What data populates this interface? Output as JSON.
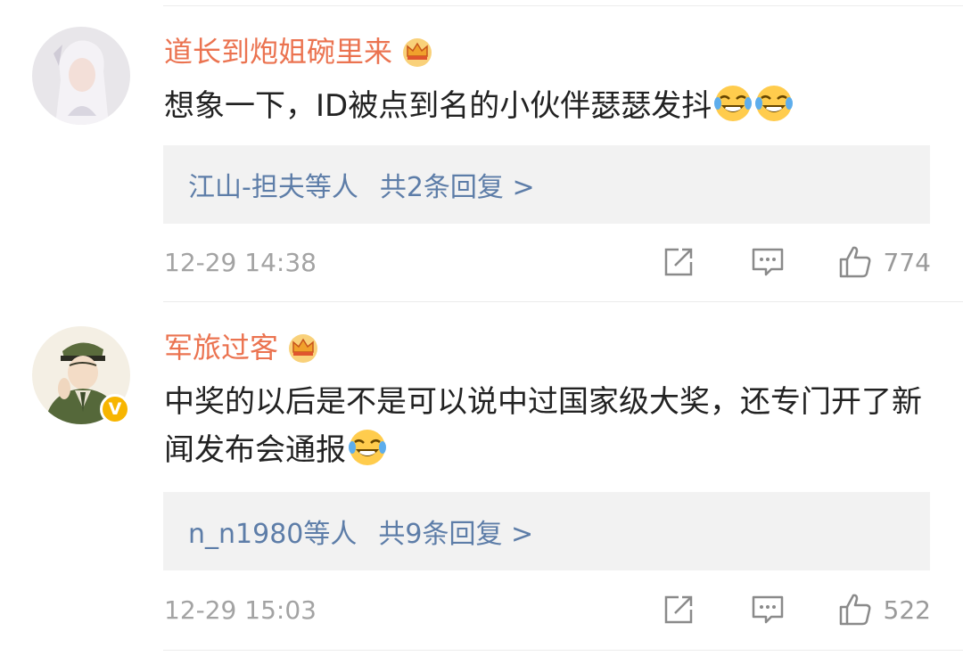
{
  "comments": [
    {
      "username": "道长到炮姐碗里来",
      "has_crown": true,
      "verified": false,
      "text": "想象一下，ID被点到名的小伙伴瑟瑟发抖",
      "emojis": [
        "laugh-cry-emoji",
        "laugh-cry-emoji"
      ],
      "reply_names": "江山-担夫等人",
      "reply_count_label": "共2条回复 >",
      "time": "12-29 14:38",
      "likes": "774"
    },
    {
      "username": "军旅过客",
      "has_crown": true,
      "verified": true,
      "verified_mark": "V",
      "text": "中奖的以后是不是可以说中过国家级大奖，还专门开了新闻发布会通报",
      "emojis": [
        "laugh-cry-emoji"
      ],
      "reply_names": "n_n1980等人",
      "reply_count_label": "共9条回复 >",
      "time": "12-29 15:03",
      "likes": "522"
    }
  ],
  "colors": {
    "username": "#eb7350",
    "link": "#5d7da8",
    "text": "#222222",
    "meta": "#a3a3a3",
    "reply_bg": "#f2f2f2",
    "badge": "#f7b500"
  }
}
